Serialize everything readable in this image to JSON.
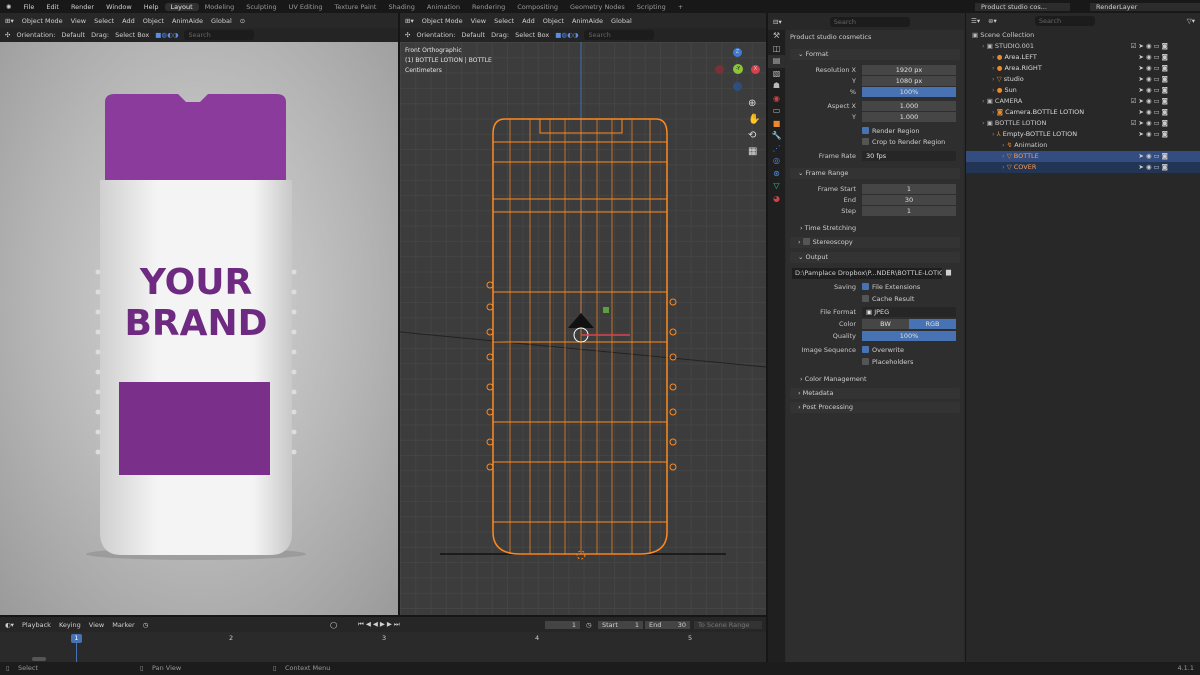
{
  "menu": {
    "items": [
      "File",
      "Edit",
      "Render",
      "Window",
      "Help"
    ],
    "workspaces": [
      "Layout",
      "Modeling",
      "Sculpting",
      "UV Editing",
      "Texture Paint",
      "Shading",
      "Animation",
      "Rendering",
      "Compositing",
      "Geometry Nodes",
      "Scripting"
    ],
    "active_workspace": "Layout",
    "scene": "Product studio cos...",
    "view_layer": "RenderLayer"
  },
  "viewport_header": {
    "mode": "Object Mode",
    "items": [
      "View",
      "Select",
      "Add",
      "Object",
      "AnimAide"
    ],
    "transform": "Global",
    "orientation_label": "Orientation:",
    "orientation": "Default",
    "drag_label": "Drag:",
    "drag": "Select Box",
    "search_placeholder": "Search"
  },
  "camera_view": {
    "brand_line1": "YOUR",
    "brand_line2": "BRAND",
    "cap_color": "#8a3b9c",
    "label_color": "#7a2f8a"
  },
  "viewport": {
    "view": "Front Orthographic",
    "object": "(1) BOTTLE LOTION | BOTTLE",
    "units": "Centimeters",
    "wire_color": "#ff8a1e",
    "gizmo": {
      "z": "Z",
      "y": "-Y",
      "x": "X"
    }
  },
  "properties": {
    "search_placeholder": "Search",
    "scene_name": "Product studio cosmetics",
    "format": {
      "title": "Format",
      "res_x_label": "Resolution X",
      "res_x": "1920 px",
      "res_y_label": "Y",
      "res_y": "1080 px",
      "pct_label": "%",
      "pct": "100%",
      "aspect_x_label": "Aspect X",
      "aspect_x": "1.000",
      "aspect_y_label": "Y",
      "aspect_y": "1.000",
      "render_region": "Render Region",
      "crop": "Crop to Render Region",
      "frame_rate_label": "Frame Rate",
      "frame_rate": "30 fps"
    },
    "frame_range": {
      "title": "Frame Range",
      "start_label": "Frame Start",
      "start": "1",
      "end_label": "End",
      "end": "30",
      "step_label": "Step",
      "step": "1",
      "time_stretching": "Time Stretching"
    },
    "stereoscopy": "Stereoscopy",
    "output": {
      "title": "Output",
      "path": "D:\\Pamplace Dropbox\\P...NDER\\BOTTLE-LOTION",
      "saving_label": "Saving",
      "file_ext": "File Extensions",
      "cache": "Cache Result",
      "format_label": "File Format",
      "format": "JPEG",
      "color_label": "Color",
      "bw": "BW",
      "rgb": "RGB",
      "quality_label": "Quality",
      "quality": "100%",
      "seq_label": "Image Sequence",
      "overwrite": "Overwrite",
      "placeholders": "Placeholders",
      "color_mgmt": "Color Management"
    },
    "metadata": "Metadata",
    "post": "Post Processing"
  },
  "outliner": {
    "search_placeholder": "Search",
    "rows": [
      {
        "label": "Scene Collection",
        "indent": 0
      },
      {
        "label": "STUDIO.001",
        "indent": 1
      },
      {
        "label": "Area.LEFT",
        "indent": 2
      },
      {
        "label": "Area.RIGHT",
        "indent": 2
      },
      {
        "label": "studio",
        "indent": 2
      },
      {
        "label": "Sun",
        "indent": 2
      },
      {
        "label": "CAMERA",
        "indent": 1
      },
      {
        "label": "Camera.BOTTLE LOTION",
        "indent": 2
      },
      {
        "label": "BOTTLE LOTION",
        "indent": 1
      },
      {
        "label": "Empty-BOTTLE LOTION",
        "indent": 2
      },
      {
        "label": "Animation",
        "indent": 3
      },
      {
        "label": "BOTTLE",
        "indent": 3
      },
      {
        "label": "COVER",
        "indent": 3
      }
    ]
  },
  "timeline": {
    "menu": [
      "Playback",
      "Keying",
      "View",
      "Marker"
    ],
    "current_frame": "1",
    "start_label": "Start",
    "start": "1",
    "end_label": "End",
    "end": "30",
    "ticks": [
      "1",
      "2",
      "3",
      "4",
      "5"
    ],
    "scene_range": "To Scene Range"
  },
  "status": {
    "select": "Select",
    "pan": "Pan View",
    "context": "Context Menu",
    "version": "4.1.1"
  }
}
